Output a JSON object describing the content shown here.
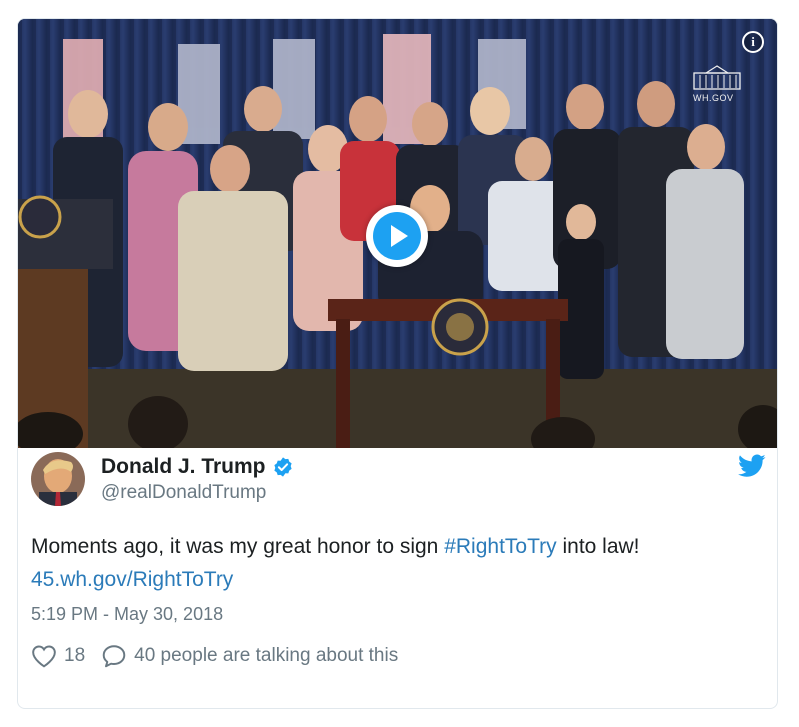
{
  "tweet": {
    "display_name": "Donald J. Trump",
    "handle": "@realDonaldTrump",
    "text_before": "Moments ago, it was my great honor to sign ",
    "hashtag": "#RightToTry",
    "text_middle": " into law! ",
    "link": "45.wh.gov/RightToTry",
    "timestamp": "5:19 PM - May 30, 2018",
    "like_count": "18",
    "talking_text": "40 people are talking about this"
  },
  "media": {
    "badge_text": "WH.GOV",
    "info_glyph": "i",
    "play_icon": "play-icon"
  },
  "colors": {
    "link": "#2b7bb9",
    "twitter_blue": "#1da1f2",
    "text": "#1c2022",
    "muted": "#697882"
  }
}
